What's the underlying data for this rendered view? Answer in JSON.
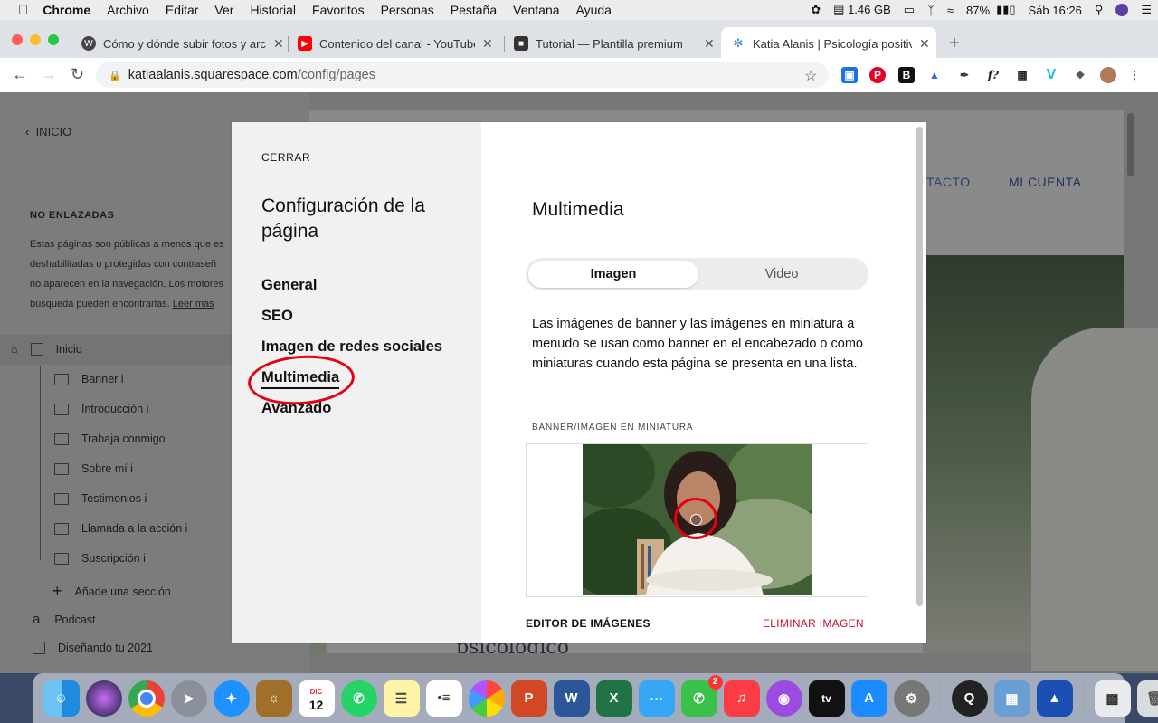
{
  "menubar": {
    "apple": "",
    "app": "Chrome",
    "items": [
      "Archivo",
      "Editar",
      "Ver",
      "Historial",
      "Favoritos",
      "Personas",
      "Pestaña",
      "Ventana",
      "Ayuda"
    ],
    "memory": "1.46 GB",
    "battery": "87%",
    "clock": "Sáb 16:26"
  },
  "browser": {
    "tabs": [
      {
        "title": "Cómo y dónde subir fotos y arc",
        "icon": "wordpress-icon"
      },
      {
        "title": "Contenido del canal - YouTube",
        "icon": "youtube-icon"
      },
      {
        "title": "Tutorial — Plantilla premium",
        "icon": "cube-icon"
      },
      {
        "title": "Katia Alanis | Psicología positiva",
        "icon": "squarespace-icon"
      }
    ],
    "new_tab": "+",
    "url_host": "katiaalanis.squarespace.com",
    "url_path": "/config/pages"
  },
  "sidebar": {
    "back_label": "INICIO",
    "section_title": "NO ENLAZADAS",
    "description_lines": [
      "Estas páginas son públicas a menos que es",
      "deshabilitadas o protegidas con contraseñ",
      "no aparecen en la navegación. Los motores",
      "búsqueda pueden encontrarlas."
    ],
    "read_more": "Leer más",
    "home": "Inicio",
    "sections": [
      "Banner i",
      "Introducción i",
      "Trabaja conmigo",
      "Sobre mí i",
      "Testimonios i",
      "Llamada a la acción i",
      "Suscripción i"
    ],
    "add_section": "Añade una sección",
    "pages": [
      "Podcast",
      "Diseñando tu 2021"
    ]
  },
  "site_preview": {
    "nav_contact": "TACTO",
    "nav_account": "MI CUENTA",
    "footer_text": "psicológico"
  },
  "modal": {
    "close": "CERRAR",
    "title": "Configuración de la página",
    "nav": [
      "General",
      "SEO",
      "Imagen de redes sociales",
      "Multimedia",
      "Avanzado"
    ],
    "active_nav": "Multimedia",
    "heading": "Multimedia",
    "tabs": {
      "active": "Imagen",
      "inactive": "Video"
    },
    "description": "Las imágenes de banner y las imágenes en miniatura a menudo se usan como banner en el encabezado o como miniaturas cuando esta página se presenta en una lista.",
    "image_label": "BANNER/IMAGEN EN MINIATURA",
    "editor": "EDITOR DE IMÁGENES",
    "delete": "ELIMINAR IMAGEN",
    "delete_color": "#c8102e",
    "highlight_color": "#e50012"
  },
  "dock": {
    "items": [
      "finder-icon",
      "siri-icon",
      "chrome-icon",
      "launchpad-icon",
      "safari-icon",
      "notes-book-icon",
      "calendar-icon",
      "whatsapp-icon",
      "notes-icon",
      "reminders-icon",
      "photos-icon",
      "powerpoint-icon",
      "word-icon",
      "excel-icon",
      "messages-icon",
      "facetime-icon",
      "music-icon",
      "podcasts-icon",
      "appletv-icon",
      "appstore-icon",
      "system-preferences-icon",
      "quicktime-icon",
      "preview-icon",
      "affinity-icon",
      "screenshot-icon",
      "trash-icon"
    ],
    "calendar_month": "DIC",
    "calendar_day": "12",
    "facetime_badge": "2"
  }
}
